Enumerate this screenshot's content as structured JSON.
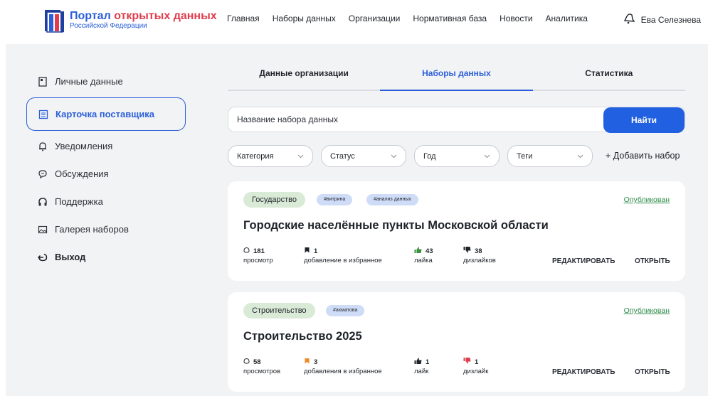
{
  "header": {
    "logo_title_part1": "Портал",
    "logo_title_part2": "открытых данных",
    "logo_subtitle": "Российской Федерации",
    "nav": [
      "Главная",
      "Наборы данных",
      "Организации",
      "Нормативная база",
      "Новости",
      "Аналитика"
    ],
    "user_name": "Ева Селезнева"
  },
  "sidebar": {
    "items": [
      {
        "label": "Личные данные",
        "icon": "document-icon"
      },
      {
        "label": "Карточка поставщика",
        "icon": "card-list-icon"
      },
      {
        "label": "Уведомления",
        "icon": "bell-icon"
      },
      {
        "label": "Обсуждения",
        "icon": "chat-icon"
      },
      {
        "label": "Поддержка",
        "icon": "headphones-icon"
      },
      {
        "label": "Галерея наборов",
        "icon": "gallery-icon"
      },
      {
        "label": "Выход",
        "icon": "logout-icon"
      }
    ]
  },
  "tabs": [
    "Данные организации",
    "Наборы данных",
    "Статистика"
  ],
  "search": {
    "placeholder": "Название набора данных",
    "button": "Найти"
  },
  "filters": [
    "Категория",
    "Статус",
    "Год",
    "Теги"
  ],
  "add_set": "+ Добавить набор",
  "colors": {
    "accent": "#2160e0",
    "published": "#2e8b4a",
    "category_chip": "#d9ead7",
    "tag_chip": "#cfdcf7"
  },
  "cards": [
    {
      "category": "Государство",
      "tags": [
        "#витрина",
        "#анализ данных"
      ],
      "status": "Опубликован",
      "title": "Городские населённые пункты Московской области",
      "views": "181",
      "views_label": "просмотр",
      "favs": "1",
      "favs_label": "добавление в избранное",
      "likes": "43",
      "likes_label": "лайка",
      "dislikes": "38",
      "dislikes_label": "дизлайков",
      "edit": "РЕДАКТИРОВАТЬ",
      "open": "ОТКРЫТЬ"
    },
    {
      "category": "Строительство",
      "tags": [
        "#ахматова"
      ],
      "status": "Опубликован",
      "title": "Строительство 2025",
      "views": "58",
      "views_label": "просмотров",
      "favs": "3",
      "favs_label": "добавления в избранное",
      "likes": "1",
      "likes_label": "лайк",
      "dislikes": "1",
      "dislikes_label": "дизлайк",
      "edit": "РЕДАКТИРОВАТЬ",
      "open": "ОТКРЫТЬ"
    }
  ]
}
